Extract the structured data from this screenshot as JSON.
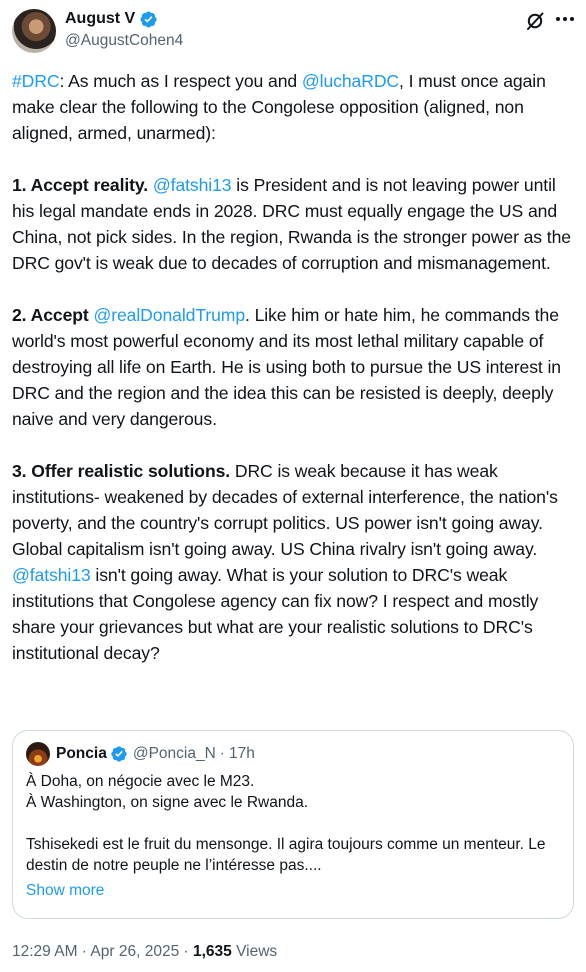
{
  "author": {
    "display_name": "August V",
    "handle": "@AugustCohen4",
    "verified_color": "#1d9bf0"
  },
  "tweet": {
    "p1": {
      "hashtag": "#DRC",
      "t1": ": As much as I respect you and ",
      "mention": "@luchaRDC",
      "t2": ", I must once again make clear the following to the Congolese opposition (aligned, non aligned, armed, unarmed):"
    },
    "p2": {
      "heading": "1. Accept reality.",
      "mention": "@fatshi13",
      "t1": " is President and is not leaving power until his legal mandate ends in 2028. DRC must equally engage the US and China, not pick sides. In the region, Rwanda is the stronger power as the DRC gov't is weak due to decades of corruption and mismanagement."
    },
    "p3": {
      "heading": "2. Accept ",
      "mention": "@realDonaldTrump",
      "t1": ". Like him or hate him, he commands the world's most powerful economy and its most lethal military capable of destroying all life on Earth. He is using both to pursue the US interest in DRC and the region and the idea this can be resisted is deeply, deeply naive and very dangerous."
    },
    "p4": {
      "heading": "3. Offer realistic solutions.",
      "t1": " DRC is weak because it has weak institutions- weakened by decades of external interference, the nation's poverty, and the country's corrupt politics.  US power isn't going away. Global capitalism isn't going away. US China rivalry isn't going away. ",
      "mention": "@fatshi13",
      "t2": " isn't going away. What is your solution to DRC's weak institutions that Congolese agency can fix now? I respect and mostly share your grievances but what are your realistic solutions to DRC's institutional decay?"
    }
  },
  "quote": {
    "display_name": "Poncia",
    "handle": "@Poncia_N",
    "separator": "·",
    "time": "17h",
    "line1": "À Doha, on négocie avec le M23.",
    "line2": "À Washington, on signe avec le Rwanda.",
    "line3": "Tshisekedi est le fruit du mensonge. Il agira toujours comme un menteur. Le destin de notre peuple ne l’intéresse pas....",
    "show_more": "Show more"
  },
  "meta": {
    "time": "12:29 AM",
    "sep1": " · ",
    "date": "Apr 26, 2025",
    "sep2": " · ",
    "views_count": "1,635",
    "views_label": " Views"
  },
  "icons": {
    "verified": "verified-badge-icon",
    "grok": "grok-icon",
    "more": "more-options-icon"
  }
}
